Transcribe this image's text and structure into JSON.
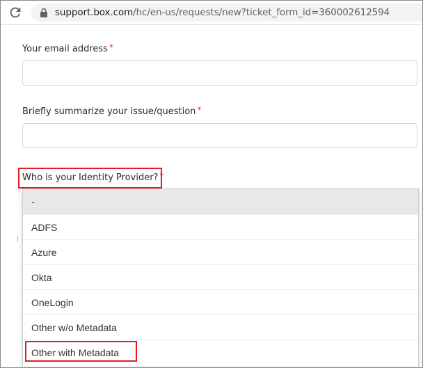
{
  "browser": {
    "url_host": "support.box.com",
    "url_path": "/hc/en-us/requests/new?ticket_form_id=360002612594"
  },
  "form": {
    "required_marker": "*",
    "email_label": "Your email address",
    "summary_label": "Briefly summarize your issue/question",
    "idp_label": "Who is your Identity Provider?",
    "idp_options": [
      "-",
      "ADFS",
      "Azure",
      "Okta",
      "OneLogin",
      "Other w/o Metadata",
      "Other with Metadata"
    ]
  },
  "colors": {
    "required": "#e8302b",
    "highlight": "#e01b24",
    "selected_option_bg": "#e8e8e8"
  }
}
